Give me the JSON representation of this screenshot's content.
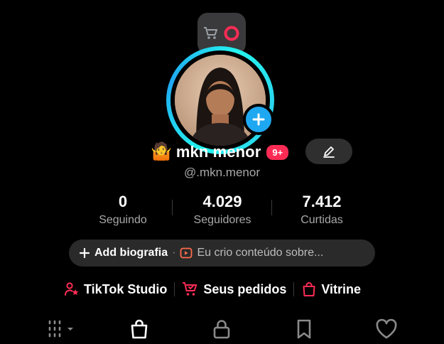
{
  "profile": {
    "name_emoji": "🤷",
    "display_name": "mkn menor",
    "notification_badge": "9+",
    "handle": "@.mkn.menor"
  },
  "stats": [
    {
      "value": "0",
      "label": "Seguindo"
    },
    {
      "value": "4.029",
      "label": "Seguidores"
    },
    {
      "value": "7.412",
      "label": "Curtidas"
    }
  ],
  "bio": {
    "add_label": "Add biografia",
    "separator": "·",
    "description": "Eu crio conteúdo sobre..."
  },
  "quick_links": [
    {
      "label": "TikTok Studio",
      "icon": "person-star-icon"
    },
    {
      "label": "Seus pedidos",
      "icon": "cart-check-icon"
    },
    {
      "label": "Vitrine",
      "icon": "shopping-bag-icon"
    }
  ],
  "tabs": [
    {
      "icon": "grid-icon",
      "active": false
    },
    {
      "icon": "shopping-bag-icon",
      "active": true
    },
    {
      "icon": "lock-icon",
      "active": false
    },
    {
      "icon": "bookmark-icon",
      "active": false
    },
    {
      "icon": "heart-icon",
      "active": false
    }
  ],
  "colors": {
    "accent": "#fe2c55",
    "ring": "#25f4ee",
    "add_button": "#1fa8f2",
    "background": "#000000"
  }
}
